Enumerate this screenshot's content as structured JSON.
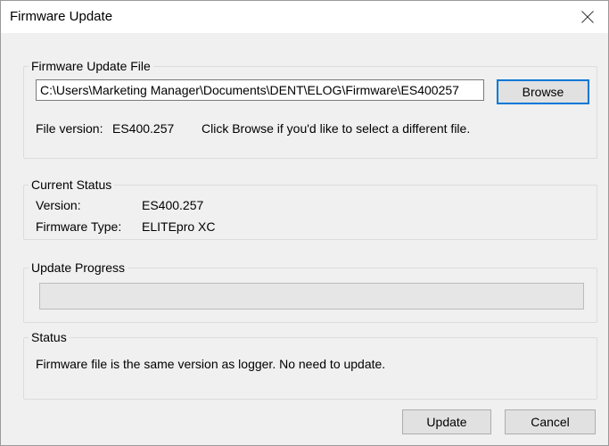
{
  "window": {
    "title": "Firmware Update"
  },
  "firmware_file": {
    "legend": "Firmware Update File",
    "path_value": "C:\\Users\\Marketing Manager\\Documents\\DENT\\ELOG\\Firmware\\ES400257",
    "browse_label": "Browse",
    "file_version_label": "File version:",
    "file_version_value": "ES400.257",
    "hint": "Click Browse if you'd like to select a different file."
  },
  "current_status": {
    "legend": "Current Status",
    "version_label": "Version:",
    "version_value": "ES400.257",
    "type_label": "Firmware Type:",
    "type_value": "ELITEpro XC"
  },
  "update_progress": {
    "legend": "Update Progress",
    "progress": 0
  },
  "status": {
    "legend": "Status",
    "message": "Firmware file is the same version as logger. No need to update."
  },
  "footer": {
    "update_label": "Update",
    "cancel_label": "Cancel"
  },
  "icons": {
    "close": "close-icon"
  },
  "colors": {
    "dialog_background": "#f0f0f0",
    "default_button_border": "#0078d7",
    "progress_fill": "#06b025"
  }
}
